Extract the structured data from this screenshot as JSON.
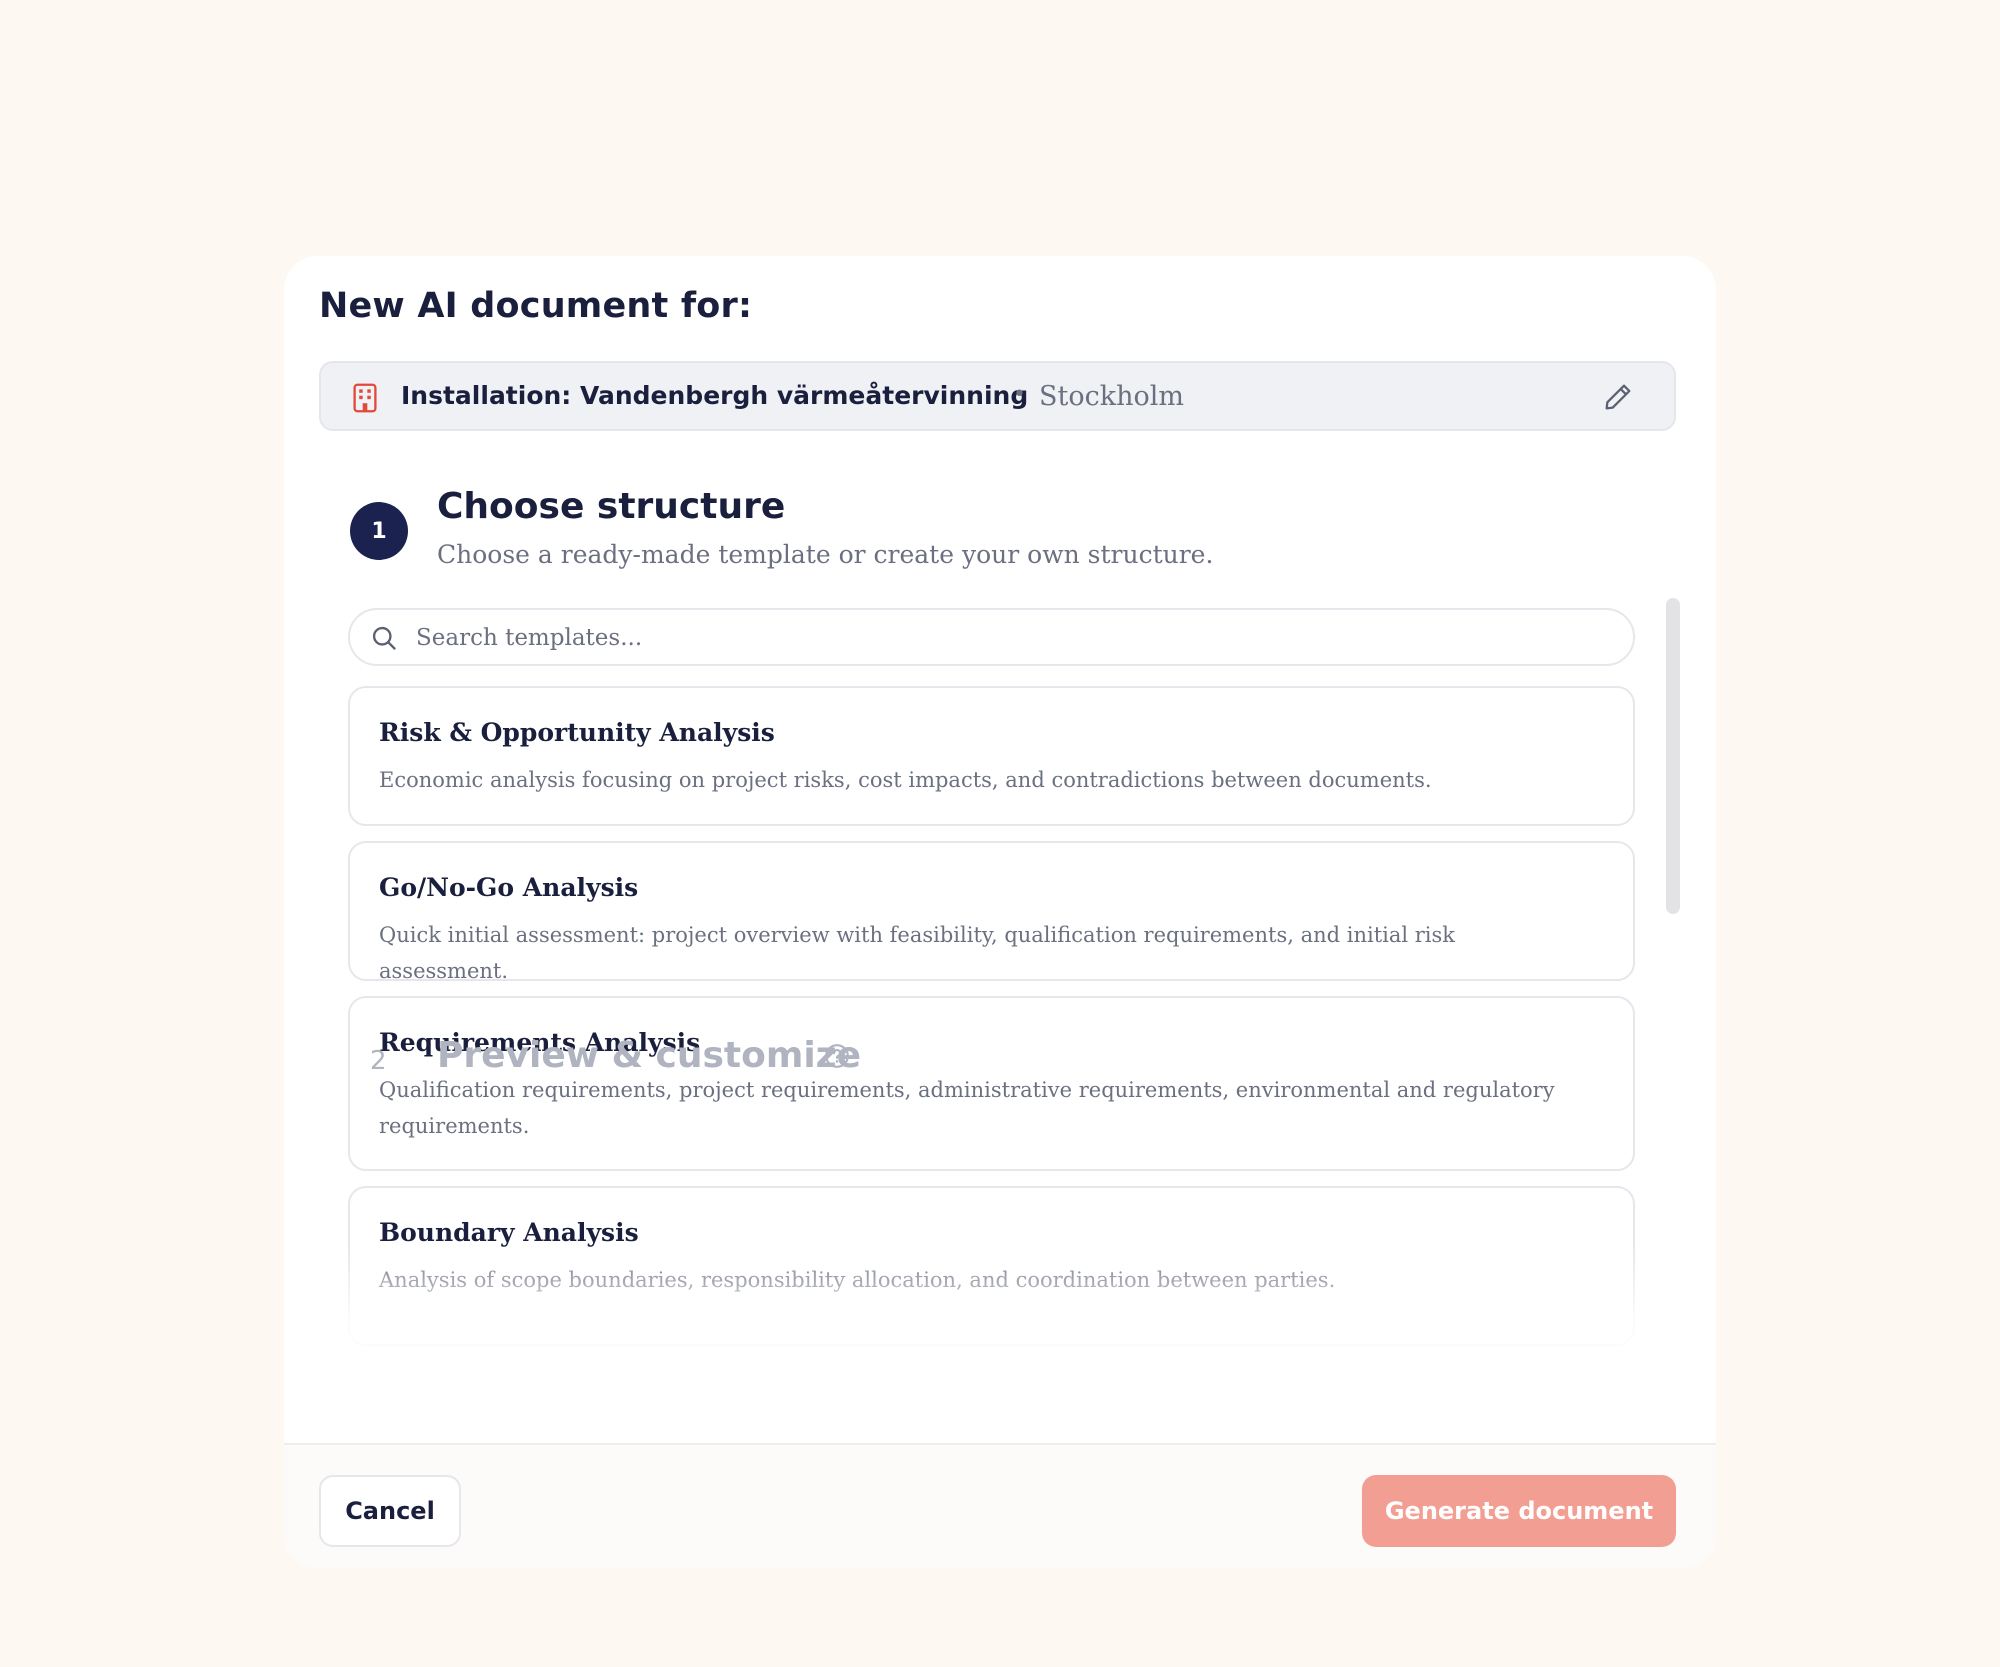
{
  "modal": {
    "title": "New AI document for:",
    "context": {
      "label": "Installation: Vandenbergh värmeåtervinning",
      "separator": "•",
      "location": "Stockholm",
      "icon": "building-icon",
      "icon_color": "#e04a3a"
    }
  },
  "step1": {
    "number": "1",
    "title": "Choose structure",
    "subtitle": "Choose a ready-made template or create your own structure."
  },
  "search": {
    "placeholder": "Search templates...",
    "value": ""
  },
  "templates": [
    {
      "title": "Risk & Opportunity Analysis",
      "description": "Economic analysis focusing on project risks, cost impacts, and contradictions between documents."
    },
    {
      "title": "Go/No-Go Analysis",
      "description": "Quick initial assessment: project overview with feasibility, qualification requirements, and initial risk assessment."
    },
    {
      "title": "Requirements Analysis",
      "description": "Qualification requirements, project requirements, administrative requirements, environmental and regulatory requirements."
    },
    {
      "title": "Boundary Analysis",
      "description": "Analysis of scope boundaries, responsibility allocation, and coordination between parties."
    }
  ],
  "step2": {
    "number": "2",
    "title": "Preview & customize"
  },
  "footer": {
    "cancel_label": "Cancel",
    "generate_label": "Generate document"
  },
  "colors": {
    "background": "#fdf8f2",
    "primary_dark": "#1b2250",
    "accent_disabled": "#f29a8e"
  }
}
